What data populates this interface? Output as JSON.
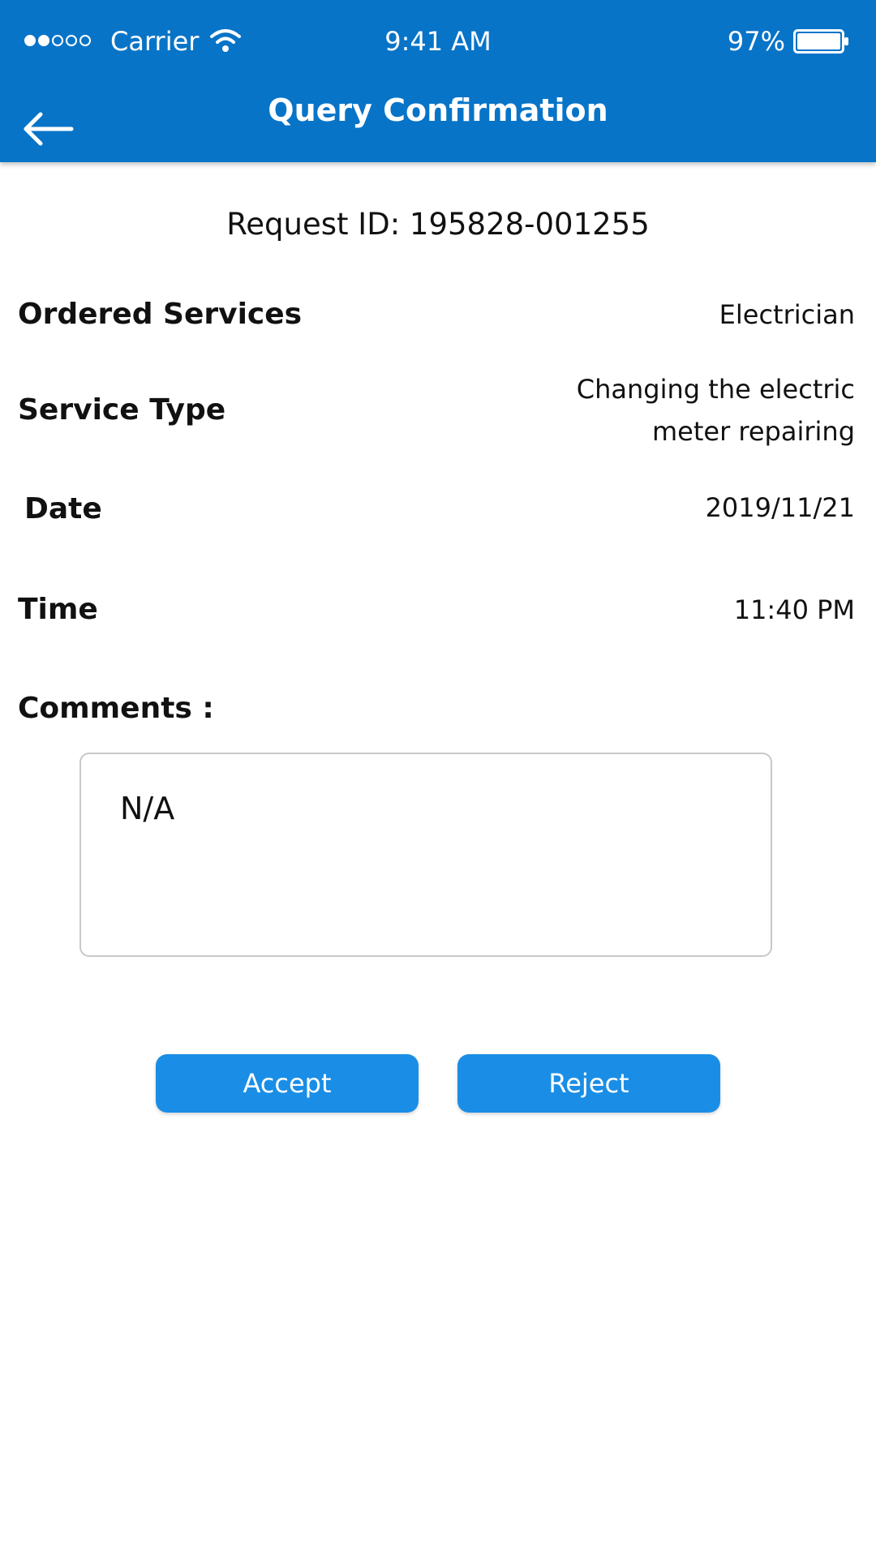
{
  "status_bar": {
    "carrier": "Carrier",
    "time": "9:41 AM",
    "battery": "97%",
    "signal_bars_filled": 2,
    "signal_bars_total": 5,
    "battery_level": 0.97
  },
  "header": {
    "title": "Query Confirmation",
    "back_icon": "arrow-left-icon",
    "background": "#0774c8"
  },
  "request": {
    "id_text": "Request ID: 195828-001255"
  },
  "details": {
    "ordered_services_label": "Ordered Services",
    "ordered_services_value": "Electrician",
    "service_type_label": "Service Type",
    "service_type_value_line1": "Changing the electric",
    "service_type_value_line2": "meter repairing",
    "date_label": "Date",
    "date_value": "2019/11/21",
    "time_label": "Time",
    "time_value": "11:40 PM"
  },
  "comments": {
    "label": "Comments :",
    "value": "N/A"
  },
  "actions": {
    "accept_label": "Accept",
    "reject_label": "Reject",
    "button_color": "#1a8ee6"
  }
}
